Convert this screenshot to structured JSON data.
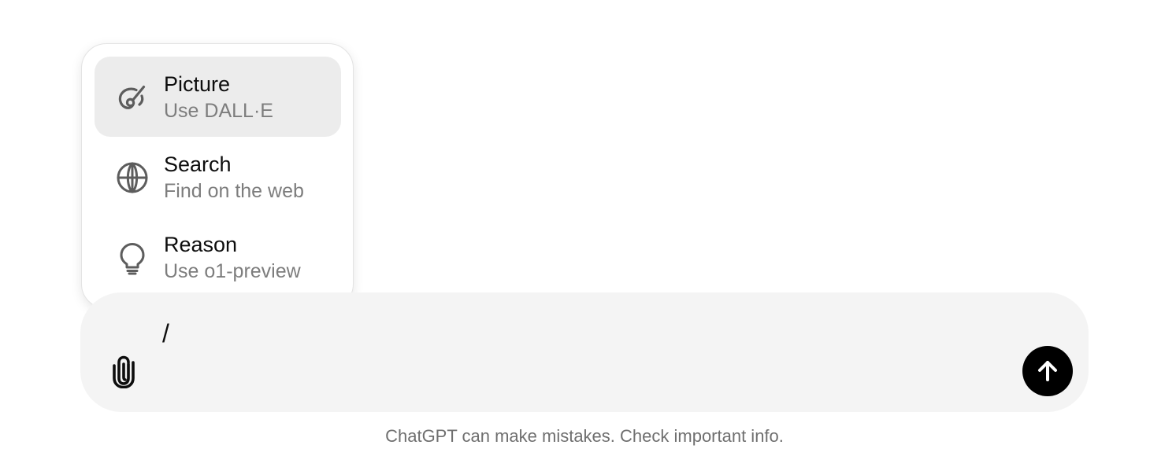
{
  "menu": {
    "items": [
      {
        "title": "Picture",
        "subtitle": "Use DALL·E",
        "icon": "paint-brush-icon",
        "active": true
      },
      {
        "title": "Search",
        "subtitle": "Find on the web",
        "icon": "globe-icon",
        "active": false
      },
      {
        "title": "Reason",
        "subtitle": "Use o1-preview",
        "icon": "lightbulb-icon",
        "active": false
      }
    ]
  },
  "composer": {
    "value": "/",
    "attach_icon": "paperclip-icon",
    "send_icon": "arrow-up-icon",
    "send_button_color": "#000000",
    "background_color": "#f4f4f4"
  },
  "footer": {
    "disclaimer": "ChatGPT can make mistakes. Check important info."
  }
}
